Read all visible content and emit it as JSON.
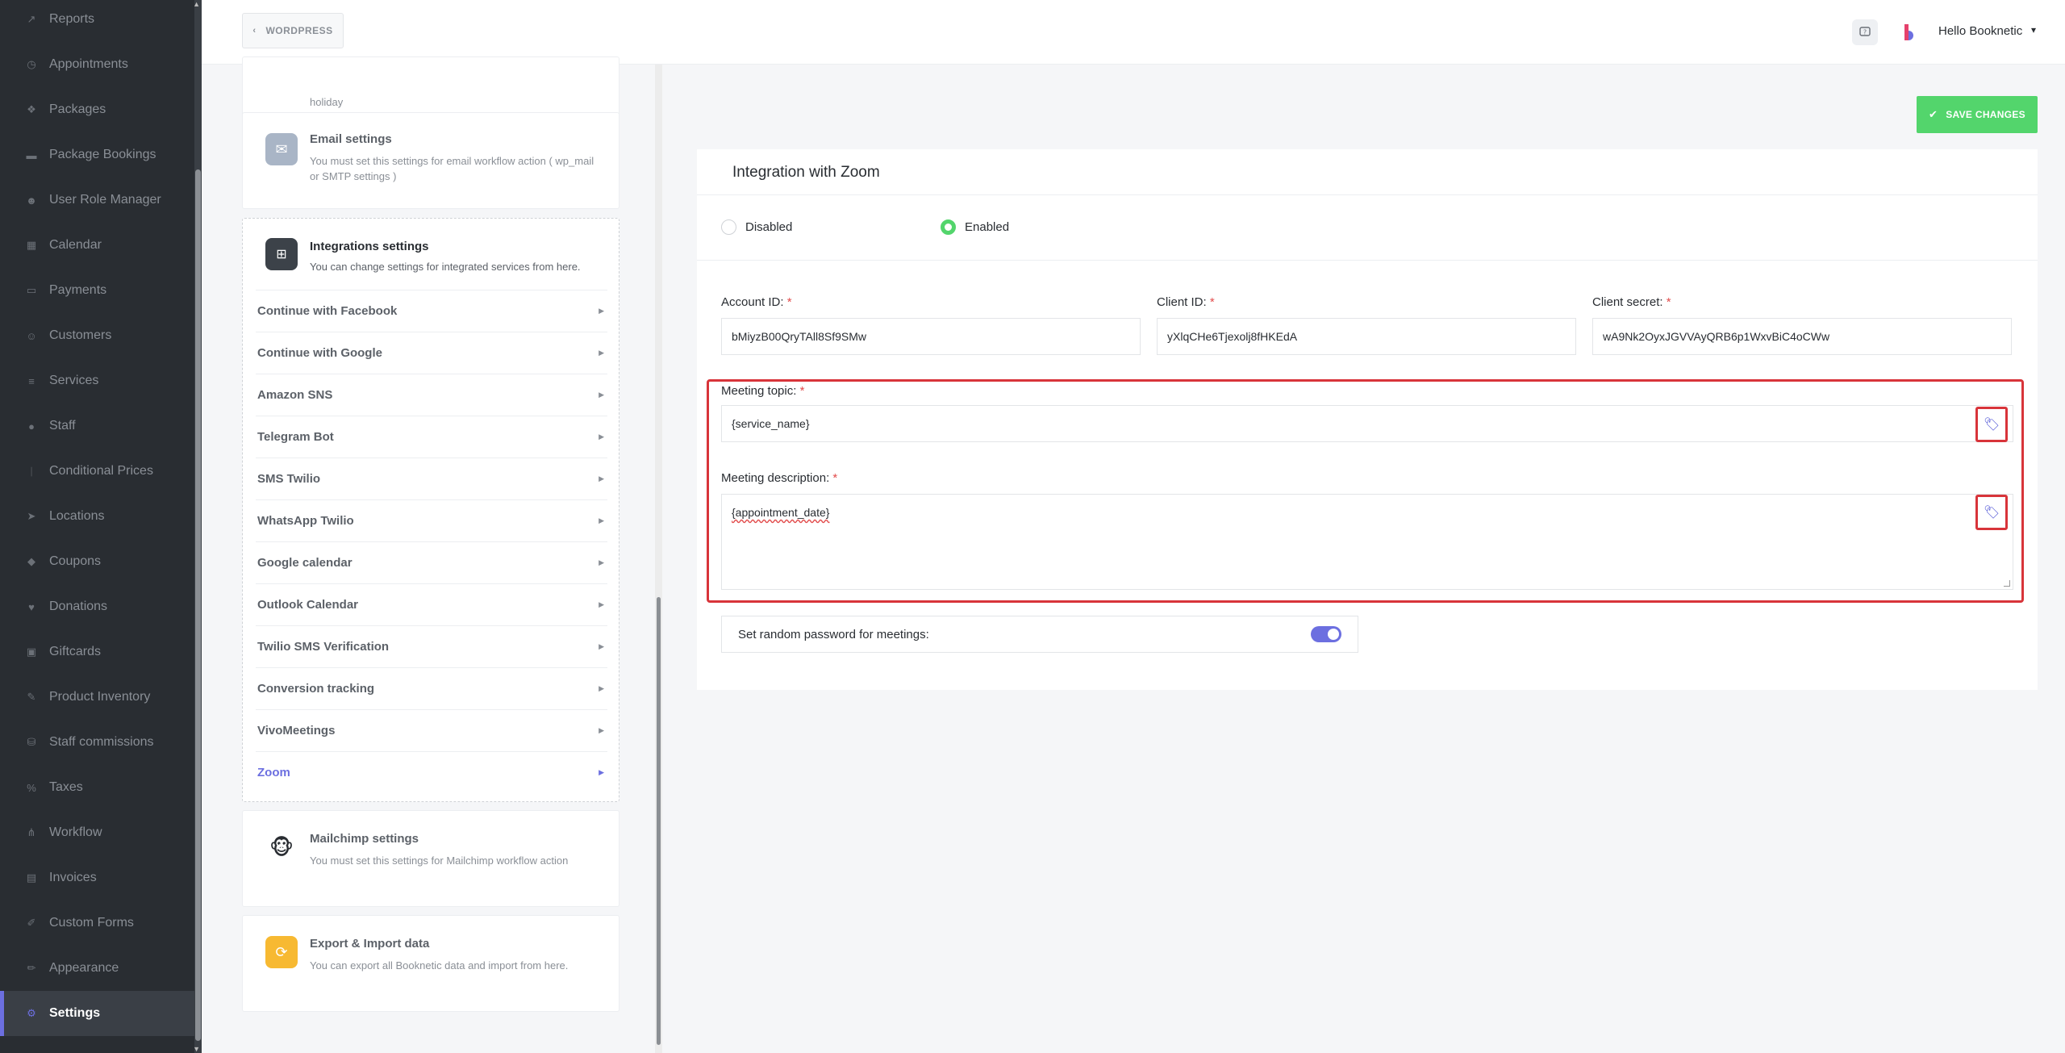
{
  "sidebar": {
    "items": [
      {
        "label": "Reports",
        "icon": "chart-icon"
      },
      {
        "label": "Appointments",
        "icon": "clock-icon"
      },
      {
        "label": "Packages",
        "icon": "package-icon"
      },
      {
        "label": "Package Bookings",
        "icon": "bed-icon"
      },
      {
        "label": "User Role Manager",
        "icon": "user-role-icon"
      },
      {
        "label": "Calendar",
        "icon": "calendar-icon"
      },
      {
        "label": "Payments",
        "icon": "payment-icon"
      },
      {
        "label": "Customers",
        "icon": "customers-icon"
      },
      {
        "label": "Services",
        "icon": "list-icon"
      },
      {
        "label": "Staff",
        "icon": "staff-icon"
      },
      {
        "label": "Conditional Prices",
        "icon": "conditional-icon"
      },
      {
        "label": "Locations",
        "icon": "location-icon"
      },
      {
        "label": "Coupons",
        "icon": "tag-icon"
      },
      {
        "label": "Donations",
        "icon": "donation-icon"
      },
      {
        "label": "Giftcards",
        "icon": "gift-icon"
      },
      {
        "label": "Product Inventory",
        "icon": "inventory-icon"
      },
      {
        "label": "Staff commissions",
        "icon": "commission-icon"
      },
      {
        "label": "Taxes",
        "icon": "percent-icon"
      },
      {
        "label": "Workflow",
        "icon": "workflow-icon"
      },
      {
        "label": "Invoices",
        "icon": "invoice-icon"
      },
      {
        "label": "Custom Forms",
        "icon": "forms-icon"
      },
      {
        "label": "Appearance",
        "icon": "brush-icon"
      },
      {
        "label": "Settings",
        "icon": "gear-icon"
      }
    ],
    "active_index": 22
  },
  "topbar": {
    "back_label": "WORDPRESS",
    "user_greeting": "Hello Booknetic"
  },
  "settings_panel": {
    "holiday_tail": "holiday",
    "email": {
      "title": "Email settings",
      "desc": "You must set this settings for email workflow action ( wp_mail or SMTP settings )"
    },
    "integrations": {
      "title": "Integrations settings",
      "desc": "You can change settings for integrated services from here.",
      "items": [
        "Continue with Facebook",
        "Continue with Google",
        "Amazon SNS",
        "Telegram Bot",
        "SMS Twilio",
        "WhatsApp Twilio",
        "Google calendar",
        "Outlook Calendar",
        "Twilio SMS Verification",
        "Conversion tracking",
        "VivoMeetings",
        "Zoom"
      ],
      "active_item": "Zoom"
    },
    "mailchimp": {
      "title": "Mailchimp settings",
      "desc": "You must set this settings for Mailchimp workflow action"
    },
    "export": {
      "title": "Export & Import data",
      "desc": "You can export all Booknetic data and import from here."
    }
  },
  "zoom": {
    "save_label": "SAVE CHANGES",
    "title": "Integration with Zoom",
    "status_options": [
      "Disabled",
      "Enabled"
    ],
    "status_selected": "Enabled",
    "account_id_label": "Account ID:",
    "account_id_value": "bMiyzB00QryTAll8Sf9SMw",
    "client_id_label": "Client ID:",
    "client_id_value": "yXlqCHe6Tjexolj8fHKEdA",
    "client_secret_label": "Client secret:",
    "client_secret_value": "wA9Nk2OyxJGVVAyQRB6p1WxvBiC4oCWw",
    "meeting_topic_label": "Meeting topic:",
    "meeting_topic_value": "{service_name}",
    "meeting_desc_label": "Meeting description:",
    "meeting_desc_value": "{appointment_date}",
    "random_pwd_label": "Set random password for meetings:",
    "random_pwd_enabled": true,
    "required_mark": "*"
  },
  "colors": {
    "accent": "#6c6fe0",
    "success": "#53d56c",
    "highlight": "#d8343a",
    "sidebar_bg": "#292d32"
  }
}
